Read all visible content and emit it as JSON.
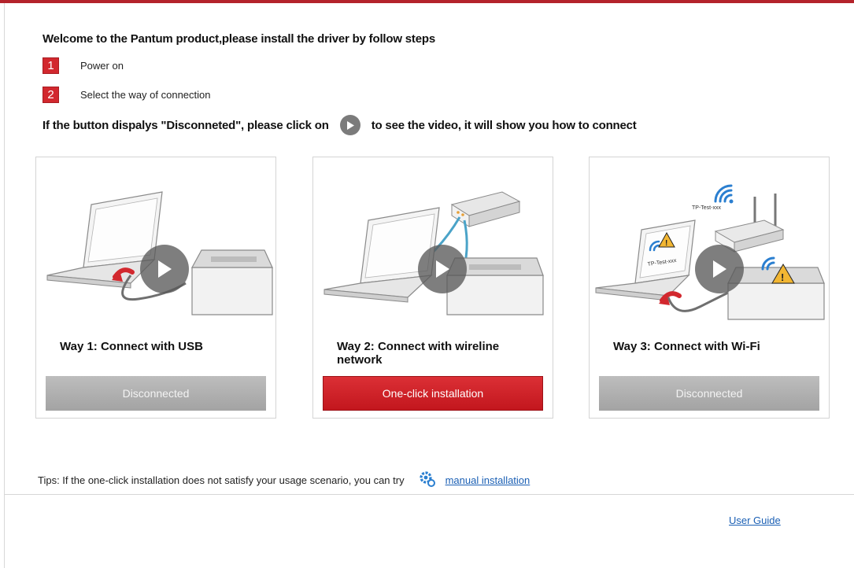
{
  "header": {
    "welcome": "Welcome to the Pantum product,please install the driver by follow steps",
    "steps": [
      {
        "num": "1",
        "label": "Power on"
      },
      {
        "num": "2",
        "label": "Select the way of connection"
      }
    ],
    "hint_before": "If the button dispalys \"Disconneted\", please click on",
    "hint_after": "to see the video, it will show you how to connect"
  },
  "cards": [
    {
      "caption": "Way 1: Connect with USB",
      "button": "Disconnected",
      "button_state": "disabled",
      "icon": "play-icon"
    },
    {
      "caption": "Way 2: Connect with wireline network",
      "button": "One-click installation",
      "button_state": "active",
      "icon": "play-icon"
    },
    {
      "caption": "Way 3: Connect with Wi-Fi",
      "button": "Disconnected",
      "button_state": "disabled",
      "icon": "play-icon"
    }
  ],
  "wifi_labels": {
    "router_ssid": "TP-Test-xxx",
    "laptop_ssid": "TP-Test-xxx"
  },
  "footer": {
    "tips_text": "Tips: If the one-click installation does not satisfy your usage scenario, you can try",
    "manual_link": "manual installation",
    "user_guide": "User Guide"
  },
  "colors": {
    "accent_red": "#d2282e",
    "disabled_gray": "#aaaaaa",
    "link_blue": "#1a5fb4"
  }
}
